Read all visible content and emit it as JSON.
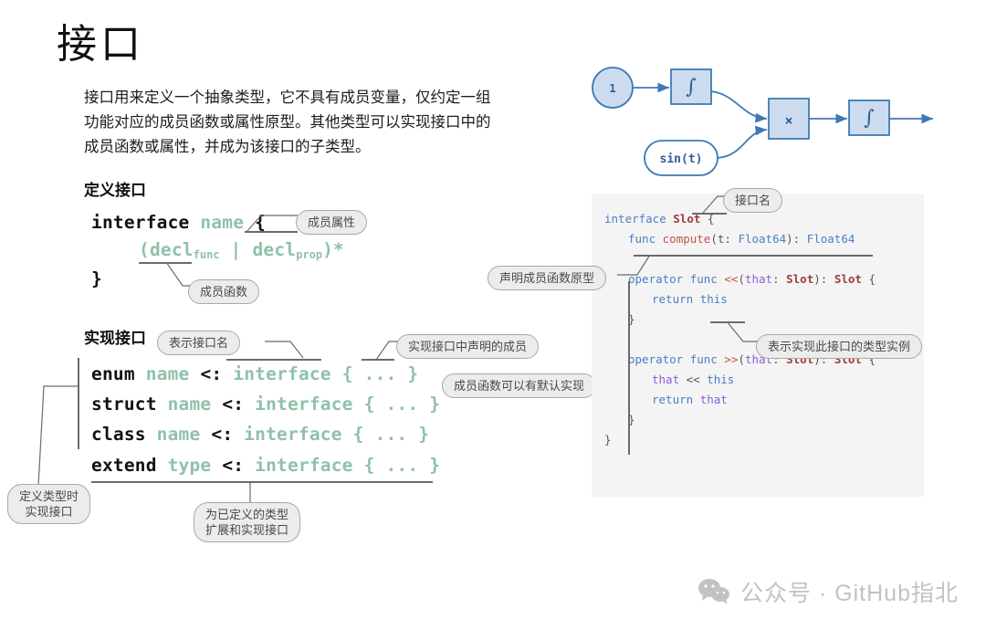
{
  "page": {
    "title": "接口",
    "intro": "接口用来定义一个抽象类型，它不具有成员变量，仅约定一组\n功能对应的成员函数或属性原型。其他类型可以实现接口中的\n成员函数或属性，并成为该接口的子类型。"
  },
  "sections": {
    "define": {
      "heading": "定义接口",
      "syntax": {
        "kw_interface": "interface",
        "id_name": "name",
        "brace_open": "{",
        "decl_open": "(decl",
        "decl_func_sub": "func",
        "decl_pipe": " | ",
        "decl_prop": "decl",
        "decl_prop_sub": "prop",
        "decl_close": ")*",
        "brace_close": "}"
      },
      "callouts": {
        "prop": "成员属性",
        "func": "成员函数"
      }
    },
    "implement": {
      "heading": "实现接口",
      "lines": [
        {
          "kw": "enum",
          "id": "name",
          "op": "<:",
          "iface": "interface",
          "body": "{ ... }"
        },
        {
          "kw": "struct",
          "id": "name",
          "op": "<:",
          "iface": "interface",
          "body": "{ ... }"
        },
        {
          "kw": "class",
          "id": "name",
          "op": "<:",
          "iface": "interface",
          "body": "{ ... }"
        },
        {
          "kw": "extend",
          "id": "type",
          "op": "<:",
          "iface": "interface",
          "body": "{ ... }"
        }
      ],
      "callouts": {
        "iface_name": "表示接口名",
        "members": "实现接口中声明的成员",
        "default_impl": "成员函数可以有默认实现",
        "define_time": "定义类型时\n实现接口",
        "extend_note": "为已定义的类型\n扩展和实现接口"
      }
    }
  },
  "flow_diagram": {
    "nodes": [
      {
        "id": "const-one",
        "shape": "circle",
        "label": "1"
      },
      {
        "id": "integral-1",
        "shape": "rect",
        "label": "∫"
      },
      {
        "id": "sin-source",
        "shape": "pill",
        "label": "sin(t)"
      },
      {
        "id": "multiply",
        "shape": "rect",
        "label": "×"
      },
      {
        "id": "integral-2",
        "shape": "rect",
        "label": "∫"
      }
    ],
    "edges": [
      {
        "from": "const-one",
        "to": "integral-1"
      },
      {
        "from": "integral-1",
        "to": "multiply"
      },
      {
        "from": "sin-source",
        "to": "multiply"
      },
      {
        "from": "multiply",
        "to": "integral-2"
      },
      {
        "from": "integral-2",
        "to": "output"
      }
    ],
    "colors": {
      "fill": "#ccdcee",
      "stroke": "#3d7ab5",
      "text": "#2f5f96"
    }
  },
  "code_panel": {
    "lines": [
      {
        "tokens": [
          {
            "t": "interface ",
            "c": "c-kw"
          },
          {
            "t": "Slot",
            "c": "c-type"
          },
          {
            "t": " {",
            "c": "c-pun"
          }
        ],
        "indent": 0
      },
      {
        "tokens": [
          {
            "t": "func ",
            "c": "c-kw"
          },
          {
            "t": "compute",
            "c": "c-fn"
          },
          {
            "t": "(t: ",
            "c": "c-pun"
          },
          {
            "t": "Float64",
            "c": "c-kw"
          },
          {
            "t": "): ",
            "c": "c-pun"
          },
          {
            "t": "Float64",
            "c": "c-kw"
          }
        ],
        "indent": 1
      },
      {
        "tokens": [],
        "indent": 0
      },
      {
        "tokens": [
          {
            "t": "operator func ",
            "c": "c-kw"
          },
          {
            "t": "<<",
            "c": "c-op"
          },
          {
            "t": "(",
            "c": "c-pun"
          },
          {
            "t": "that",
            "c": "c-var"
          },
          {
            "t": ": ",
            "c": "c-pun"
          },
          {
            "t": "Slot",
            "c": "c-type"
          },
          {
            "t": "): ",
            "c": "c-pun"
          },
          {
            "t": "Slot",
            "c": "c-type"
          },
          {
            "t": " {",
            "c": "c-pun"
          }
        ],
        "indent": 1
      },
      {
        "tokens": [
          {
            "t": "return ",
            "c": "c-kw"
          },
          {
            "t": "this",
            "c": "c-kw"
          }
        ],
        "indent": 2
      },
      {
        "tokens": [
          {
            "t": "}",
            "c": "c-pun"
          }
        ],
        "indent": 1
      },
      {
        "tokens": [],
        "indent": 0
      },
      {
        "tokens": [
          {
            "t": "operator func ",
            "c": "c-kw"
          },
          {
            "t": ">>",
            "c": "c-op"
          },
          {
            "t": "(",
            "c": "c-pun"
          },
          {
            "t": "that",
            "c": "c-var"
          },
          {
            "t": ": ",
            "c": "c-pun"
          },
          {
            "t": "Slot",
            "c": "c-type"
          },
          {
            "t": "): ",
            "c": "c-pun"
          },
          {
            "t": "Slot",
            "c": "c-type"
          },
          {
            "t": " {",
            "c": "c-pun"
          }
        ],
        "indent": 1
      },
      {
        "tokens": [
          {
            "t": "that",
            "c": "c-var"
          },
          {
            "t": " << ",
            "c": "c-pun"
          },
          {
            "t": "this",
            "c": "c-kw"
          }
        ],
        "indent": 2
      },
      {
        "tokens": [
          {
            "t": "return ",
            "c": "c-kw"
          },
          {
            "t": "that",
            "c": "c-var"
          }
        ],
        "indent": 2
      },
      {
        "tokens": [
          {
            "t": "}",
            "c": "c-pun"
          }
        ],
        "indent": 1
      },
      {
        "tokens": [
          {
            "t": "}",
            "c": "c-pun"
          }
        ],
        "indent": 0
      }
    ],
    "callouts": {
      "iface_name": "接口名",
      "func_proto": "声明成员函数原型",
      "this_note": "表示实现此接口的类型实例"
    }
  },
  "footer": {
    "text": "公众号 · GitHub指北",
    "icon": "wechat-icon"
  }
}
